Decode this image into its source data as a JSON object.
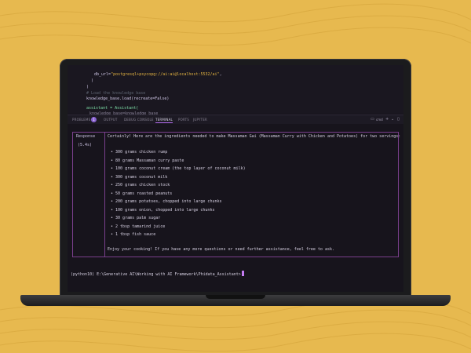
{
  "colors": {
    "background": "#e7b94f",
    "accent": "#b46cf0",
    "box_border": "#7a3f8c"
  },
  "editor": {
    "lines": [
      {
        "num": "",
        "pre": "db_url=",
        "str": "\"postgresql+psycopg://ai:ai@localhost:5532/ai\"",
        "post": ","
      },
      {
        "num": "",
        "text": ")"
      },
      {
        "num": "",
        "text": ")"
      },
      {
        "num": "",
        "comment": "# Load the knowledge base"
      },
      {
        "num": "",
        "text": "knowledge_base.load(recreate=False)"
      },
      {
        "num": "",
        "text": ""
      },
      {
        "num": "",
        "text": "assistant = Assistant("
      },
      {
        "num": "",
        "text": "knowledge_base=knowledge_base"
      }
    ]
  },
  "panel": {
    "tabs": [
      "PROBLEMS",
      "OUTPUT",
      "DEBUG CONSOLE",
      "TERMINAL",
      "PORTS",
      "JUPYTER"
    ],
    "problems_count": "1",
    "active_tab": "TERMINAL",
    "shell_label": "cmd",
    "plus_icon": "+",
    "split_icon": "⌄",
    "more_icon": "▯"
  },
  "terminal": {
    "response_label_1": "Response",
    "response_label_2": "(5.4s)",
    "intro": "Certainly! Here are the ingredients needed to make Massaman Gai (Massaman Curry with Chicken and Potatoes) for two servings:",
    "ingredients": [
      "300 grams chicken rump",
      "80 grams Massaman curry paste",
      "100 grams coconut cream (the top layer of coconut milk)",
      "300 grams coconut milk",
      "250 grams chicken stock",
      "50 grams roasted peanuts",
      "200 grams potatoes, chopped into large chunks",
      "100 grams onion, chopped into large chunks",
      "30 grams palm sugar",
      "2 tbsp tamarind juice",
      "1 tbsp fish sauce"
    ],
    "outro": "Enjoy your cooking! If you have any more questions or need further assistance, feel free to ask.",
    "prompt": "(python10) E:\\Generative AI\\Working with AI Framework\\Phidata_Assistant>"
  }
}
